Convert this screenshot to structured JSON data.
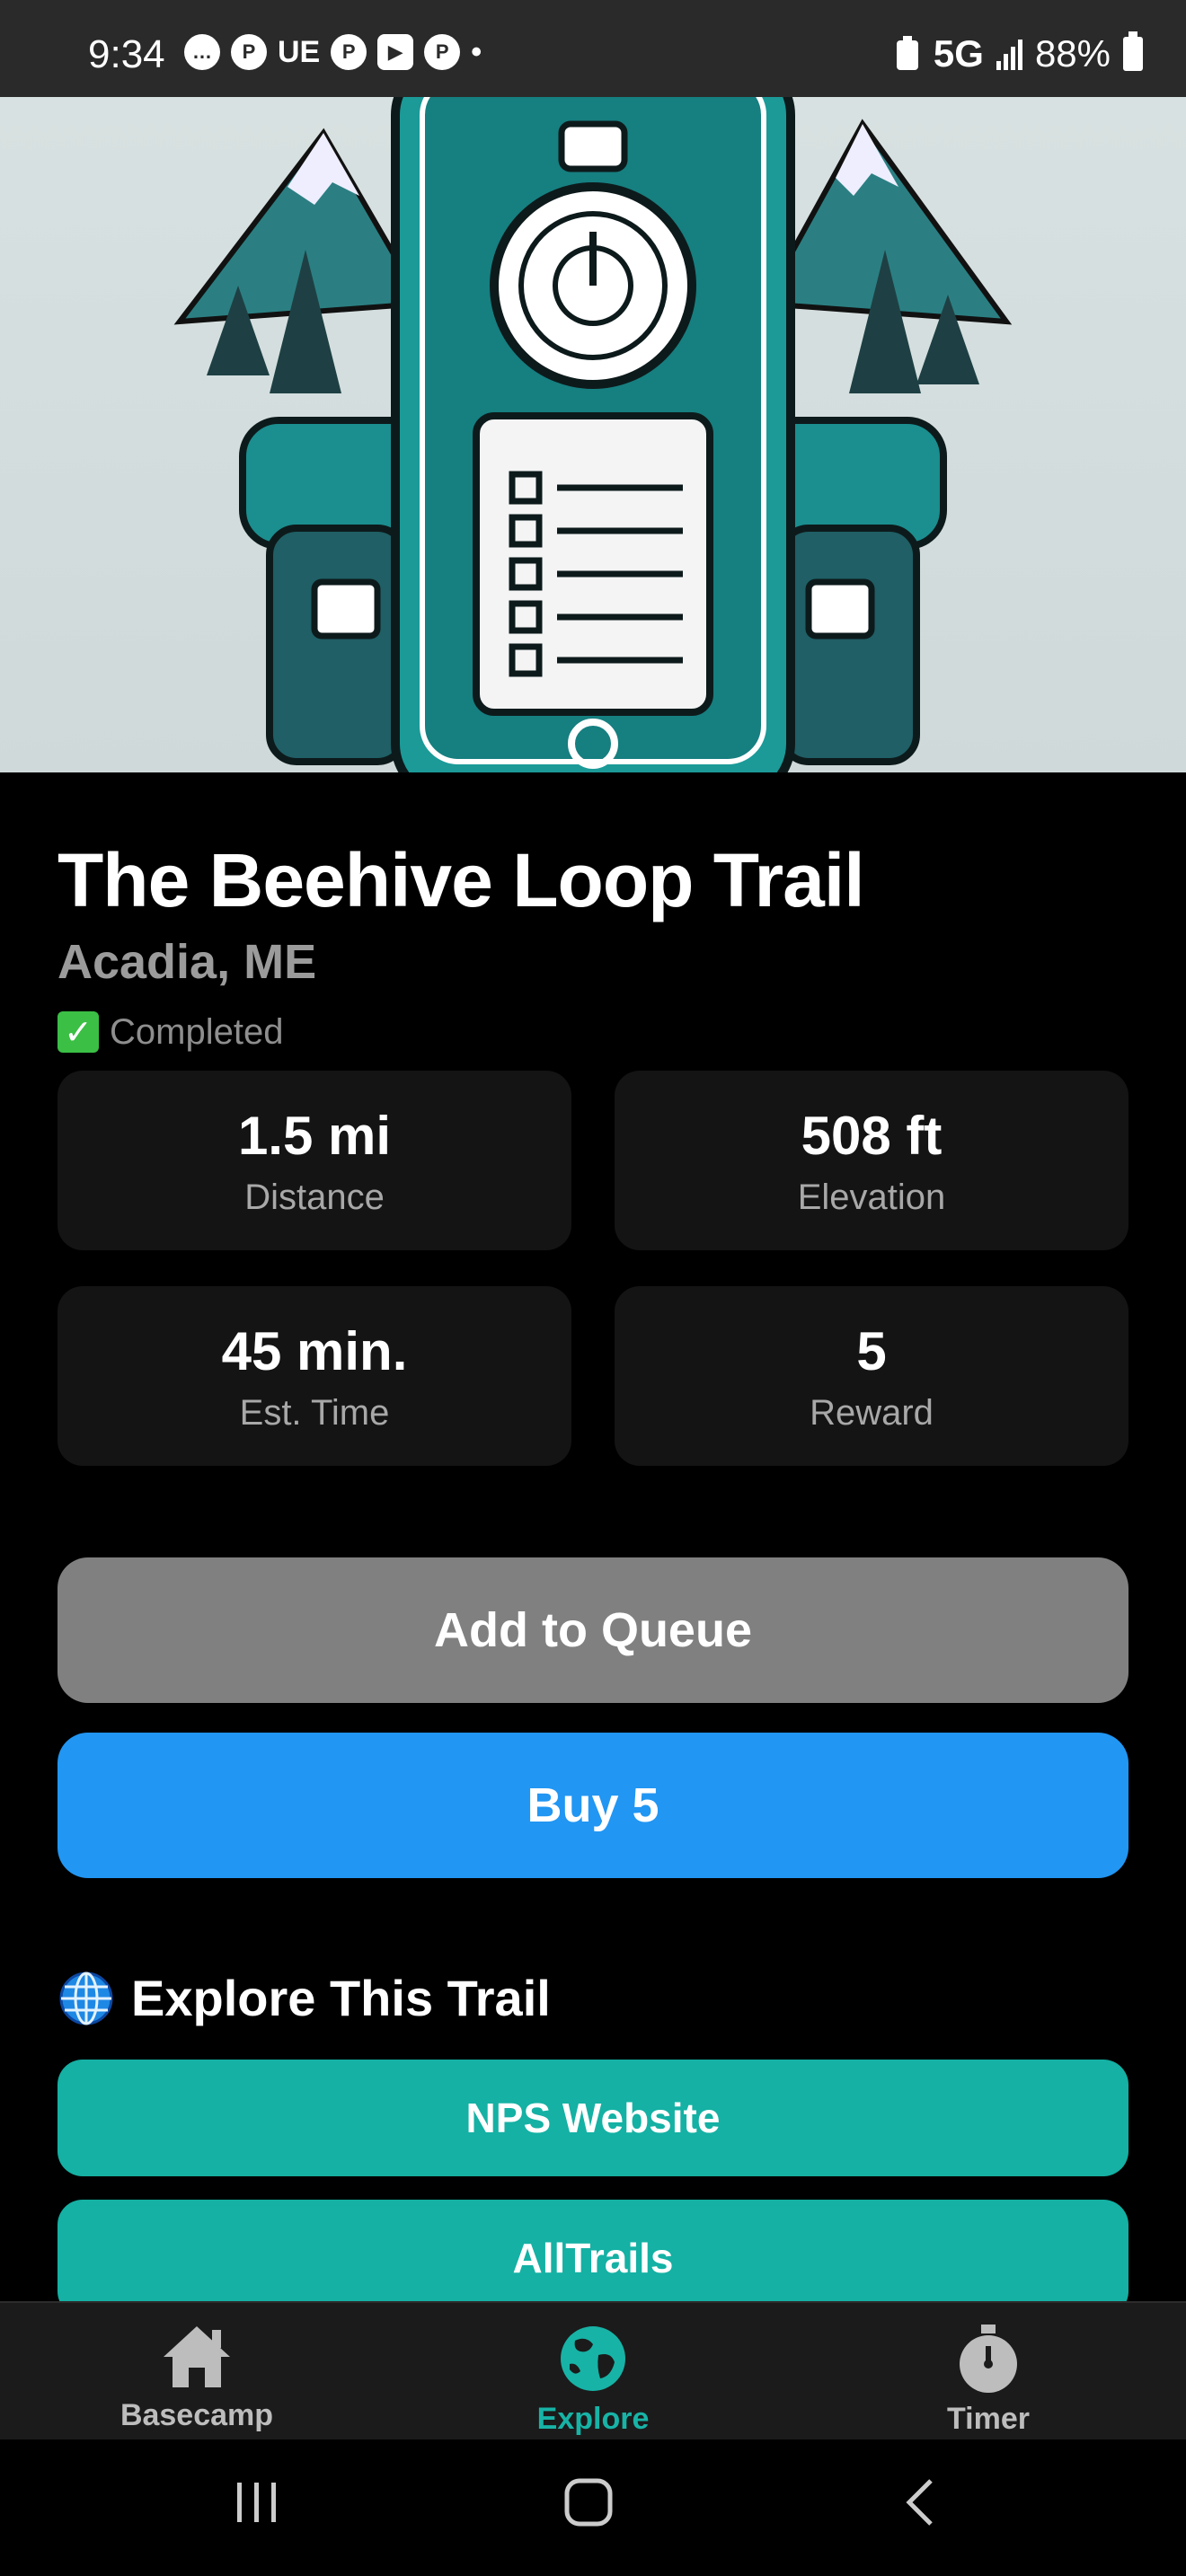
{
  "status_bar": {
    "time": "9:34",
    "notif_text": "UE",
    "network": "5G",
    "battery": "88%"
  },
  "trail": {
    "title": "The Beehive Loop Trail",
    "location": "Acadia, ME",
    "status": "Completed"
  },
  "stats": [
    {
      "value": "1.5 mi",
      "label": "Distance"
    },
    {
      "value": "508 ft",
      "label": "Elevation"
    },
    {
      "value": "45 min.",
      "label": "Est. Time"
    },
    {
      "value": "5",
      "label": "Reward"
    }
  ],
  "actions": {
    "queue_label": "Add to Queue",
    "buy_label": "Buy 5"
  },
  "explore": {
    "title": "Explore This Trail",
    "links": [
      "NPS Website",
      "AllTrails"
    ]
  },
  "bottom_nav": {
    "items": [
      {
        "label": "Basecamp",
        "icon": "house-icon"
      },
      {
        "label": "Explore",
        "icon": "globe-icon",
        "active": true
      },
      {
        "label": "Timer",
        "icon": "stopwatch-icon"
      }
    ]
  },
  "colors": {
    "accent_teal": "#14b1a4",
    "buy_blue": "#2196f3",
    "queue_gray": "#808080"
  }
}
